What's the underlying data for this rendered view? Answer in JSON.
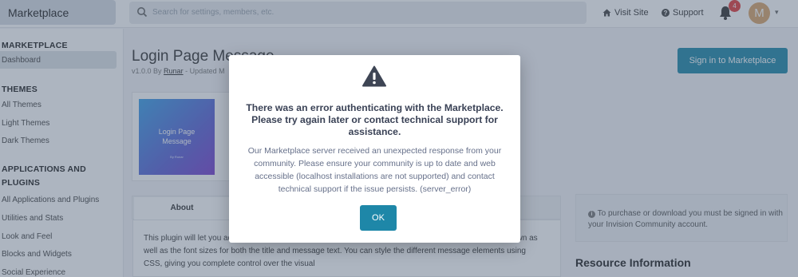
{
  "header": {
    "brand": "Marketplace",
    "search_placeholder": "Search for settings, members, etc.",
    "visit_site": "Visit Site",
    "support": "Support",
    "notification_count": "4",
    "avatar_letter": "M"
  },
  "sidebar": {
    "marketplace_heading": "MARKETPLACE",
    "dashboard": "Dashboard",
    "themes_heading": "THEMES",
    "all_themes": "All Themes",
    "light_themes": "Light Themes",
    "dark_themes": "Dark Themes",
    "apps_heading_line1": "APPLICATIONS AND",
    "apps_heading_line2": "PLUGINS",
    "all_apps": "All Applications and Plugins",
    "utilities": "Utilities and Stats",
    "look_feel": "Look and Feel",
    "blocks": "Blocks and Widgets",
    "social": "Social Experience"
  },
  "main": {
    "title": "Login Page Message",
    "byline_prefix": "v1.0.0 By",
    "author": "Runar",
    "byline_suffix": "- Updated M",
    "signin_button": "Sign in to Marketplace",
    "thumb_line1": "Login Page",
    "thumb_line2": "Message",
    "thumb_author": "By Runar",
    "tab_about": "About",
    "description": "This plugin will let you add a message above the login form, and you can easily change the text being shown as well as the font sizes for both the title and message text. You can style the different message elements using CSS, giving you complete control over the visual",
    "notice": "To purchase or download you must be signed in with your Invision Community account.",
    "resource_info": "Resource Information"
  },
  "modal": {
    "title": "There was an error authenticating with the Marketplace. Please try again later or contact technical support for assistance.",
    "body": "Our Marketplace server received an unexpected response from your community. Please ensure your community is up to date and web accessible (localhost installations are not supported) and contact technical support if the issue persists. (server_error)",
    "ok_label": "OK"
  },
  "colors": {
    "accent": "#1e87a8",
    "badge": "#e23b3b",
    "avatar": "#d9a56a"
  }
}
